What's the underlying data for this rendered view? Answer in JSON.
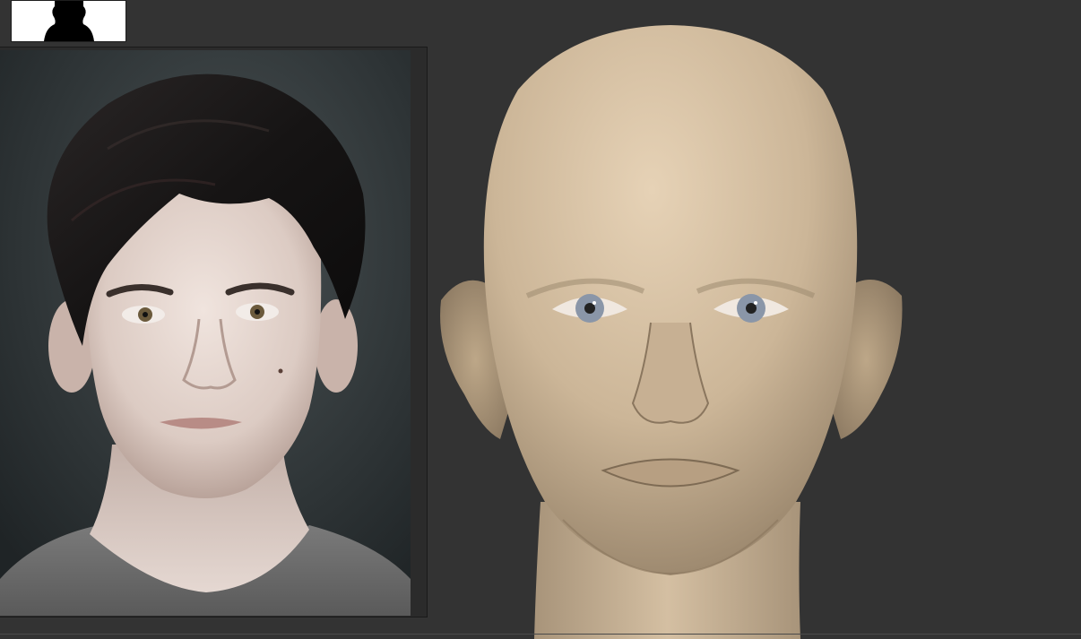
{
  "colors": {
    "background": "#333333",
    "skin_model": "#cdb69a",
    "skin_photo": "#e2d3cc",
    "hair": "#1c1a1a",
    "sweater": "#6c6c6c",
    "photo_backdrop": "#2e3436",
    "model_eye": "#8a96a8"
  },
  "icons": {
    "thumbnail": "head-silhouette-icon"
  }
}
